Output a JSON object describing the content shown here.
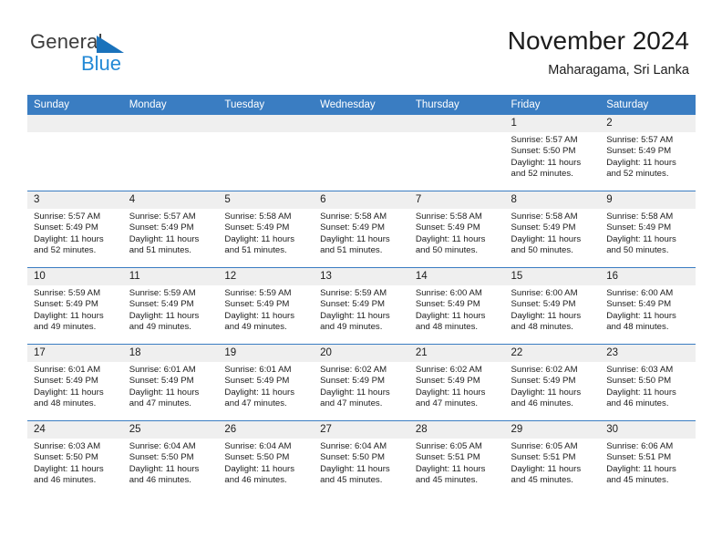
{
  "logo": {
    "primary_text": "General",
    "secondary_text": "Blue",
    "triangle_color": "#1a72bb",
    "secondary_color": "#2389d6"
  },
  "header": {
    "title": "November 2024",
    "subtitle": "Maharagama, Sri Lanka"
  },
  "theme": {
    "header_blue": "#3a7dc2",
    "daynum_bg": "#efefef",
    "text": "#1c1c1c"
  },
  "weekday_headers": [
    "Sunday",
    "Monday",
    "Tuesday",
    "Wednesday",
    "Thursday",
    "Friday",
    "Saturday"
  ],
  "labels": {
    "sunrise_prefix": "Sunrise:",
    "sunset_prefix": "Sunset:",
    "daylight_prefix": "Daylight:"
  },
  "weeks": [
    [
      {
        "day": "",
        "blank": true,
        "sunrise": "",
        "sunset": "",
        "daylight": ""
      },
      {
        "day": "",
        "blank": true,
        "sunrise": "",
        "sunset": "",
        "daylight": ""
      },
      {
        "day": "",
        "blank": true,
        "sunrise": "",
        "sunset": "",
        "daylight": ""
      },
      {
        "day": "",
        "blank": true,
        "sunrise": "",
        "sunset": "",
        "daylight": ""
      },
      {
        "day": "",
        "blank": true,
        "sunrise": "",
        "sunset": "",
        "daylight": ""
      },
      {
        "day": "1",
        "blank": false,
        "sunrise": "Sunrise: 5:57 AM",
        "sunset": "Sunset: 5:50 PM",
        "daylight": "Daylight: 11 hours and 52 minutes."
      },
      {
        "day": "2",
        "blank": false,
        "sunrise": "Sunrise: 5:57 AM",
        "sunset": "Sunset: 5:49 PM",
        "daylight": "Daylight: 11 hours and 52 minutes."
      }
    ],
    [
      {
        "day": "3",
        "blank": false,
        "sunrise": "Sunrise: 5:57 AM",
        "sunset": "Sunset: 5:49 PM",
        "daylight": "Daylight: 11 hours and 52 minutes."
      },
      {
        "day": "4",
        "blank": false,
        "sunrise": "Sunrise: 5:57 AM",
        "sunset": "Sunset: 5:49 PM",
        "daylight": "Daylight: 11 hours and 51 minutes."
      },
      {
        "day": "5",
        "blank": false,
        "sunrise": "Sunrise: 5:58 AM",
        "sunset": "Sunset: 5:49 PM",
        "daylight": "Daylight: 11 hours and 51 minutes."
      },
      {
        "day": "6",
        "blank": false,
        "sunrise": "Sunrise: 5:58 AM",
        "sunset": "Sunset: 5:49 PM",
        "daylight": "Daylight: 11 hours and 51 minutes."
      },
      {
        "day": "7",
        "blank": false,
        "sunrise": "Sunrise: 5:58 AM",
        "sunset": "Sunset: 5:49 PM",
        "daylight": "Daylight: 11 hours and 50 minutes."
      },
      {
        "day": "8",
        "blank": false,
        "sunrise": "Sunrise: 5:58 AM",
        "sunset": "Sunset: 5:49 PM",
        "daylight": "Daylight: 11 hours and 50 minutes."
      },
      {
        "day": "9",
        "blank": false,
        "sunrise": "Sunrise: 5:58 AM",
        "sunset": "Sunset: 5:49 PM",
        "daylight": "Daylight: 11 hours and 50 minutes."
      }
    ],
    [
      {
        "day": "10",
        "blank": false,
        "sunrise": "Sunrise: 5:59 AM",
        "sunset": "Sunset: 5:49 PM",
        "daylight": "Daylight: 11 hours and 49 minutes."
      },
      {
        "day": "11",
        "blank": false,
        "sunrise": "Sunrise: 5:59 AM",
        "sunset": "Sunset: 5:49 PM",
        "daylight": "Daylight: 11 hours and 49 minutes."
      },
      {
        "day": "12",
        "blank": false,
        "sunrise": "Sunrise: 5:59 AM",
        "sunset": "Sunset: 5:49 PM",
        "daylight": "Daylight: 11 hours and 49 minutes."
      },
      {
        "day": "13",
        "blank": false,
        "sunrise": "Sunrise: 5:59 AM",
        "sunset": "Sunset: 5:49 PM",
        "daylight": "Daylight: 11 hours and 49 minutes."
      },
      {
        "day": "14",
        "blank": false,
        "sunrise": "Sunrise: 6:00 AM",
        "sunset": "Sunset: 5:49 PM",
        "daylight": "Daylight: 11 hours and 48 minutes."
      },
      {
        "day": "15",
        "blank": false,
        "sunrise": "Sunrise: 6:00 AM",
        "sunset": "Sunset: 5:49 PM",
        "daylight": "Daylight: 11 hours and 48 minutes."
      },
      {
        "day": "16",
        "blank": false,
        "sunrise": "Sunrise: 6:00 AM",
        "sunset": "Sunset: 5:49 PM",
        "daylight": "Daylight: 11 hours and 48 minutes."
      }
    ],
    [
      {
        "day": "17",
        "blank": false,
        "sunrise": "Sunrise: 6:01 AM",
        "sunset": "Sunset: 5:49 PM",
        "daylight": "Daylight: 11 hours and 48 minutes."
      },
      {
        "day": "18",
        "blank": false,
        "sunrise": "Sunrise: 6:01 AM",
        "sunset": "Sunset: 5:49 PM",
        "daylight": "Daylight: 11 hours and 47 minutes."
      },
      {
        "day": "19",
        "blank": false,
        "sunrise": "Sunrise: 6:01 AM",
        "sunset": "Sunset: 5:49 PM",
        "daylight": "Daylight: 11 hours and 47 minutes."
      },
      {
        "day": "20",
        "blank": false,
        "sunrise": "Sunrise: 6:02 AM",
        "sunset": "Sunset: 5:49 PM",
        "daylight": "Daylight: 11 hours and 47 minutes."
      },
      {
        "day": "21",
        "blank": false,
        "sunrise": "Sunrise: 6:02 AM",
        "sunset": "Sunset: 5:49 PM",
        "daylight": "Daylight: 11 hours and 47 minutes."
      },
      {
        "day": "22",
        "blank": false,
        "sunrise": "Sunrise: 6:02 AM",
        "sunset": "Sunset: 5:49 PM",
        "daylight": "Daylight: 11 hours and 46 minutes."
      },
      {
        "day": "23",
        "blank": false,
        "sunrise": "Sunrise: 6:03 AM",
        "sunset": "Sunset: 5:50 PM",
        "daylight": "Daylight: 11 hours and 46 minutes."
      }
    ],
    [
      {
        "day": "24",
        "blank": false,
        "sunrise": "Sunrise: 6:03 AM",
        "sunset": "Sunset: 5:50 PM",
        "daylight": "Daylight: 11 hours and 46 minutes."
      },
      {
        "day": "25",
        "blank": false,
        "sunrise": "Sunrise: 6:04 AM",
        "sunset": "Sunset: 5:50 PM",
        "daylight": "Daylight: 11 hours and 46 minutes."
      },
      {
        "day": "26",
        "blank": false,
        "sunrise": "Sunrise: 6:04 AM",
        "sunset": "Sunset: 5:50 PM",
        "daylight": "Daylight: 11 hours and 46 minutes."
      },
      {
        "day": "27",
        "blank": false,
        "sunrise": "Sunrise: 6:04 AM",
        "sunset": "Sunset: 5:50 PM",
        "daylight": "Daylight: 11 hours and 45 minutes."
      },
      {
        "day": "28",
        "blank": false,
        "sunrise": "Sunrise: 6:05 AM",
        "sunset": "Sunset: 5:51 PM",
        "daylight": "Daylight: 11 hours and 45 minutes."
      },
      {
        "day": "29",
        "blank": false,
        "sunrise": "Sunrise: 6:05 AM",
        "sunset": "Sunset: 5:51 PM",
        "daylight": "Daylight: 11 hours and 45 minutes."
      },
      {
        "day": "30",
        "blank": false,
        "sunrise": "Sunrise: 6:06 AM",
        "sunset": "Sunset: 5:51 PM",
        "daylight": "Daylight: 11 hours and 45 minutes."
      }
    ]
  ]
}
